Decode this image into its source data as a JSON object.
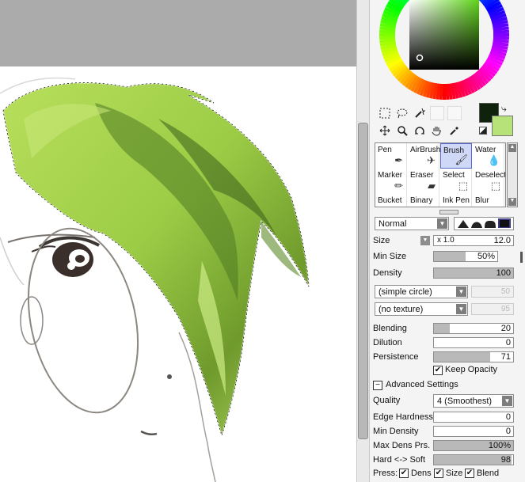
{
  "colors": {
    "main_color": "#0f220b",
    "sub_color": "#b7e27a",
    "hair": "#a8d34e",
    "hair_dark": "#3b5f1c"
  },
  "tools": [
    "marquee-icon",
    "lasso-icon",
    "magic-wand-icon",
    "move-icon",
    "zoom-icon",
    "rotate-icon",
    "hand-icon",
    "eyedropper-icon"
  ],
  "brushes": [
    {
      "label": "Pen",
      "icon": "pen-icon",
      "selected": false
    },
    {
      "label": "AirBrush",
      "icon": "airbrush-icon",
      "selected": false
    },
    {
      "label": "Brush",
      "icon": "brush-icon",
      "selected": true
    },
    {
      "label": "Water",
      "icon": "water-icon",
      "selected": false
    },
    {
      "label": "Marker",
      "icon": "marker-icon",
      "selected": false
    },
    {
      "label": "Eraser",
      "icon": "eraser-icon",
      "selected": false
    },
    {
      "label": "Select",
      "icon": "select-icon",
      "selected": false
    },
    {
      "label": "Deselect",
      "icon": "deselect-icon",
      "selected": false
    },
    {
      "label": "Bucket",
      "icon": "bucket-icon",
      "selected": false
    },
    {
      "label": "Binary",
      "icon": "binary-icon",
      "selected": false
    },
    {
      "label": "Ink Pen",
      "icon": "ink-pen-icon",
      "selected": false
    },
    {
      "label": "Blur",
      "icon": "blur-icon",
      "selected": false
    }
  ],
  "blend_mode": "Normal",
  "size": {
    "label": "Size",
    "multiplier": "x 1.0",
    "value": "12.0"
  },
  "min_size": {
    "label": "Min Size",
    "value": "50%",
    "fraction": 0.5
  },
  "density": {
    "label": "Density",
    "value": "100",
    "fraction": 1.0
  },
  "shape_select": "(simple circle)",
  "shape_value": "50",
  "texture_select": "(no texture)",
  "texture_value": "95",
  "blending": {
    "label": "Blending",
    "value": "20",
    "fraction": 0.2
  },
  "dilution": {
    "label": "Dilution",
    "value": "0",
    "fraction": 0
  },
  "persistence": {
    "label": "Persistence",
    "value": "71",
    "fraction": 0.71
  },
  "keep_opacity": "Keep Opacity",
  "advanced_settings": "Advanced Settings",
  "quality": {
    "label": "Quality",
    "value": "4 (Smoothest)"
  },
  "edge_hardness": {
    "label": "Edge Hardness",
    "value": "0",
    "fraction": 0
  },
  "min_density": {
    "label": "Min Density",
    "value": "0",
    "fraction": 0
  },
  "max_dens_prs": {
    "label": "Max Dens Prs.",
    "value": "100%",
    "fraction": 1.0
  },
  "hard_soft": {
    "label": "Hard <-> Soft",
    "value": "98",
    "fraction": 0.98
  },
  "press": {
    "label": "Press:",
    "dens": "Dens",
    "size": "Size",
    "blend": "Blend"
  }
}
